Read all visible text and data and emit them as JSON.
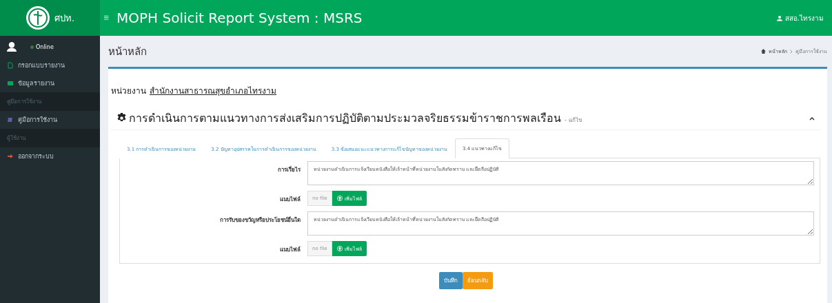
{
  "header": {
    "brand": "ศปท.",
    "title": "MOPH Solicit Report System : MSRS",
    "user": "สสอ.ไทรงาม"
  },
  "sidebar": {
    "status": "Online",
    "items": [
      {
        "kind": "link",
        "label": "กรอกแบบรายงาน",
        "selected": false
      },
      {
        "kind": "link",
        "label": "ข้อมูลรายงาน",
        "selected": false
      },
      {
        "kind": "header",
        "label": "คู่มือการใช้งาน"
      },
      {
        "kind": "link",
        "label": "คู่มือการใช้งาน",
        "selected": false
      },
      {
        "kind": "header",
        "label": "ผู้ใช้งาน"
      },
      {
        "kind": "link",
        "label": "ออกจากระบบ",
        "selected": false
      }
    ]
  },
  "page": {
    "title": "หน้าหลัก",
    "breadcrumb": [
      "หน้าหลัก",
      "คู่มือการใช้งาน"
    ]
  },
  "unit": {
    "label": "หน่วยงาน",
    "value": "สำนักงานสาธารณสุขอำเภอไทรงาม"
  },
  "section": {
    "title": "การดำเนินการตามแนวทางการส่งเสริมการปฏิบัติตามประมวลจริยธรรมข้าราชการพลเรือน",
    "suffix": "- แก้ไข",
    "expanded": true
  },
  "tabs": [
    {
      "label": "3.1 การดำเนินการของหน่วยงาน",
      "selected": false
    },
    {
      "label": "3.2 ปัญหาอุปสรรคในการดำเนินการของหน่วยงาน",
      "selected": false
    },
    {
      "label": "3.3 ข้อเสนอแนะแนวทางการแก้ไขปัญหาของหน่วยงาน",
      "selected": false
    },
    {
      "label": "3.4 แนวทางแก้ไข",
      "selected": true
    }
  ],
  "form": [
    {
      "kind": "textarea",
      "label": "การเรี่ยไร",
      "value": "หน่วยงานดำเนินการแจ้งเวียนหนังสือให้เจ้าหน้าที่หน่วยงานในสังกัดทราบ และยึดถือปฏิบัติ"
    },
    {
      "kind": "file",
      "label": "แนบไฟล์",
      "file": "no file",
      "button": "เพิ่มไฟล์"
    },
    {
      "kind": "textarea",
      "label": "การรับของขวัญหรือประโยชน์อื่นใด",
      "value": "หน่วยงานดำเนินการแจ้งเวียนหนังสือให้เจ้าหน้าที่หน่วยงานในสังกัดทราบ และยึดถือปฏิบัติ"
    },
    {
      "kind": "file",
      "label": "แนบไฟล์",
      "file": "no file",
      "button": "เพิ่มไฟล์"
    }
  ],
  "buttons": [
    {
      "kind": "primary",
      "label": "บันทึก"
    },
    {
      "kind": "warning",
      "label": "ย้อนกลับ"
    }
  ]
}
